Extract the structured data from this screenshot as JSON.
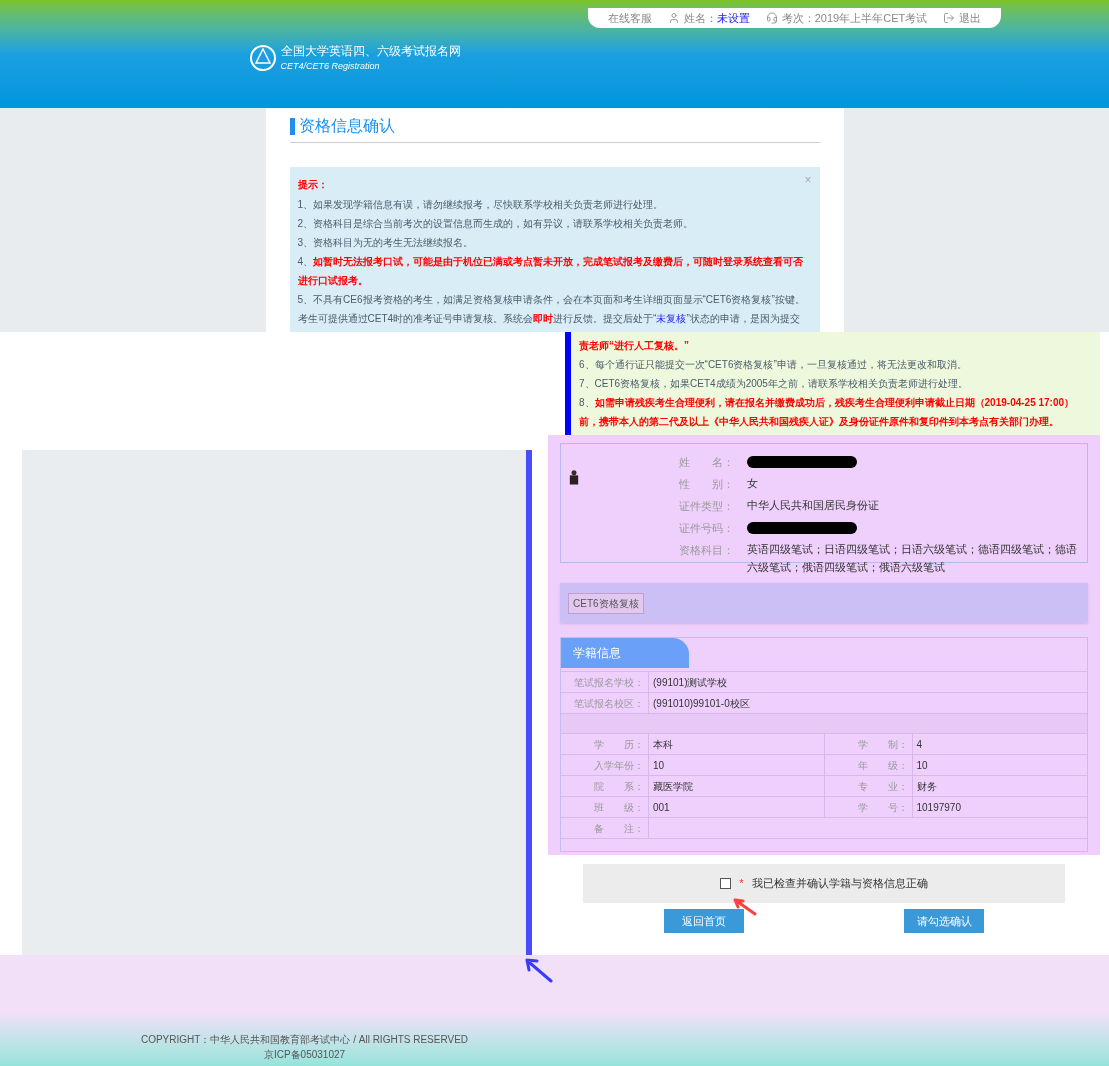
{
  "topbar": {
    "items": [
      {
        "kind": "service",
        "label": "在线客服"
      },
      {
        "kind": "user",
        "label": "姓名：",
        "value": "未设置"
      },
      {
        "kind": "exam",
        "label": "考次：2019年上半年CET考试"
      },
      {
        "kind": "logout",
        "label": "退出"
      }
    ]
  },
  "logo": {
    "title": "全国大学英语四、六级考试报名网",
    "subtitle": "CET4/CET6 Registration"
  },
  "page_title": "资格信息确认",
  "notice_top": {
    "heading": "提示：",
    "close": "×",
    "items": [
      [
        {
          "kind": "normal",
          "text": "1、如果发现学籍信息有误，请勿继续报考，尽快联系学校相关负责老师进行处理。"
        }
      ],
      [
        {
          "kind": "normal",
          "text": "2、资格科目是综合当前考次的设置信息而生成的，如有异议，请联系学校相关负责老师。"
        }
      ],
      [
        {
          "kind": "normal",
          "text": "3、资格科目为无的考生无法继续报名。"
        }
      ],
      [
        {
          "kind": "normal",
          "text": "4、"
        },
        {
          "kind": "alert",
          "text": "如暂时无法报考口试，可能是由于机位已满或考点暂未开放，完成笔试报考及缴费后，可随时登录系统查看可否进行口试报考。"
        }
      ],
      [
        {
          "kind": "normal",
          "text": "5、不具有CE6报考资格的考生，如满足资格复核申请条件，会在本页面和考生详细页面显示“CET6资格复核”按键。考生可提供通过CET4时的准考证号申请复核。系统会"
        },
        {
          "kind": "alert",
          "text": "即时"
        },
        {
          "kind": "normal",
          "text": "进行反馈。提交后处于“"
        },
        {
          "kind": "link",
          "text": "未复核"
        },
        {
          "kind": "normal",
          "text": "”状态的申请，是因为提交"
        }
      ]
    ]
  },
  "notice_bottom": {
    "items": [
      [
        {
          "kind": "alert",
          "text": "责老师“进行人工复核。”"
        }
      ],
      [
        {
          "kind": "normal",
          "text": "6、每个通行证只能提交一次“CET6资格复核”申请，一旦复核通过，将无法更改和取消。"
        }
      ],
      [
        {
          "kind": "normal",
          "text": "7、CET6资格复核，如果CET4成绩为2005年之前，请联系学校相关负责老师进行处理。"
        }
      ],
      [
        {
          "kind": "normal",
          "text": "8、"
        },
        {
          "kind": "alert",
          "text": "如需申请残疾考生合理便利，请在报名并缴费成功后，残疾考生合理便利申请截止日期（2019-04-25 17:00）前，携带本人的第二代及以上《中华人民共和国残疾人证》及身份证件原件和复印件到本考点有关部门办理。"
        }
      ]
    ]
  },
  "profile": {
    "fields": [
      {
        "kind": "redacted",
        "label": "姓　　名："
      },
      {
        "kind": "text",
        "label": "性　　别：",
        "value": "女"
      },
      {
        "kind": "text",
        "label": "证件类型：",
        "value": "中华人民共和国居民身份证"
      },
      {
        "kind": "redacted",
        "label": "证件号码："
      },
      {
        "kind": "text",
        "label": "资格科目：",
        "value": "英语四级笔试；日语四级笔试；日语六级笔试；德语四级笔试；德语六级笔试；俄语四级笔试；俄语六级笔试"
      }
    ]
  },
  "recheck_button": "CET6资格复核",
  "student_info": {
    "tab": "学籍信息",
    "rows": [
      {
        "kind": "wide",
        "label": "笔试报名学校：",
        "value": "(99101)测试学校"
      },
      {
        "kind": "wide",
        "label": "笔试报名校区：",
        "value": "(991010)99101-0校区"
      },
      {
        "kind": "blank"
      },
      {
        "kind": "pair",
        "cells": [
          {
            "label": "学　　历：",
            "value": "本科"
          },
          {
            "label": "学　　制：",
            "value": "4"
          }
        ]
      },
      {
        "kind": "pair",
        "cells": [
          {
            "label": "入学年份：",
            "value": "10"
          },
          {
            "label": "年　　级：",
            "value": "10"
          }
        ]
      },
      {
        "kind": "pair",
        "cells": [
          {
            "label": "院　　系：",
            "value": "藏医学院"
          },
          {
            "label": "专　　业：",
            "value": "财务"
          }
        ]
      },
      {
        "kind": "pair",
        "cells": [
          {
            "label": "班　　级：",
            "value": "001"
          },
          {
            "label": "学　　号：",
            "value": "10197970"
          }
        ]
      },
      {
        "kind": "wide",
        "label": "备　　注："
      }
    ]
  },
  "confirm": {
    "required_mark": "*",
    "label": "我已检查并确认学籍与资格信息正确",
    "checked": false
  },
  "buttons": [
    {
      "label": "返回首页"
    },
    {
      "label": "请勾选确认"
    }
  ],
  "footer": {
    "copyright": "COPYRIGHT：中华人民共和国教育部考试中心 / All RIGHTS RESERVED",
    "icp": "京ICP备05031027"
  }
}
